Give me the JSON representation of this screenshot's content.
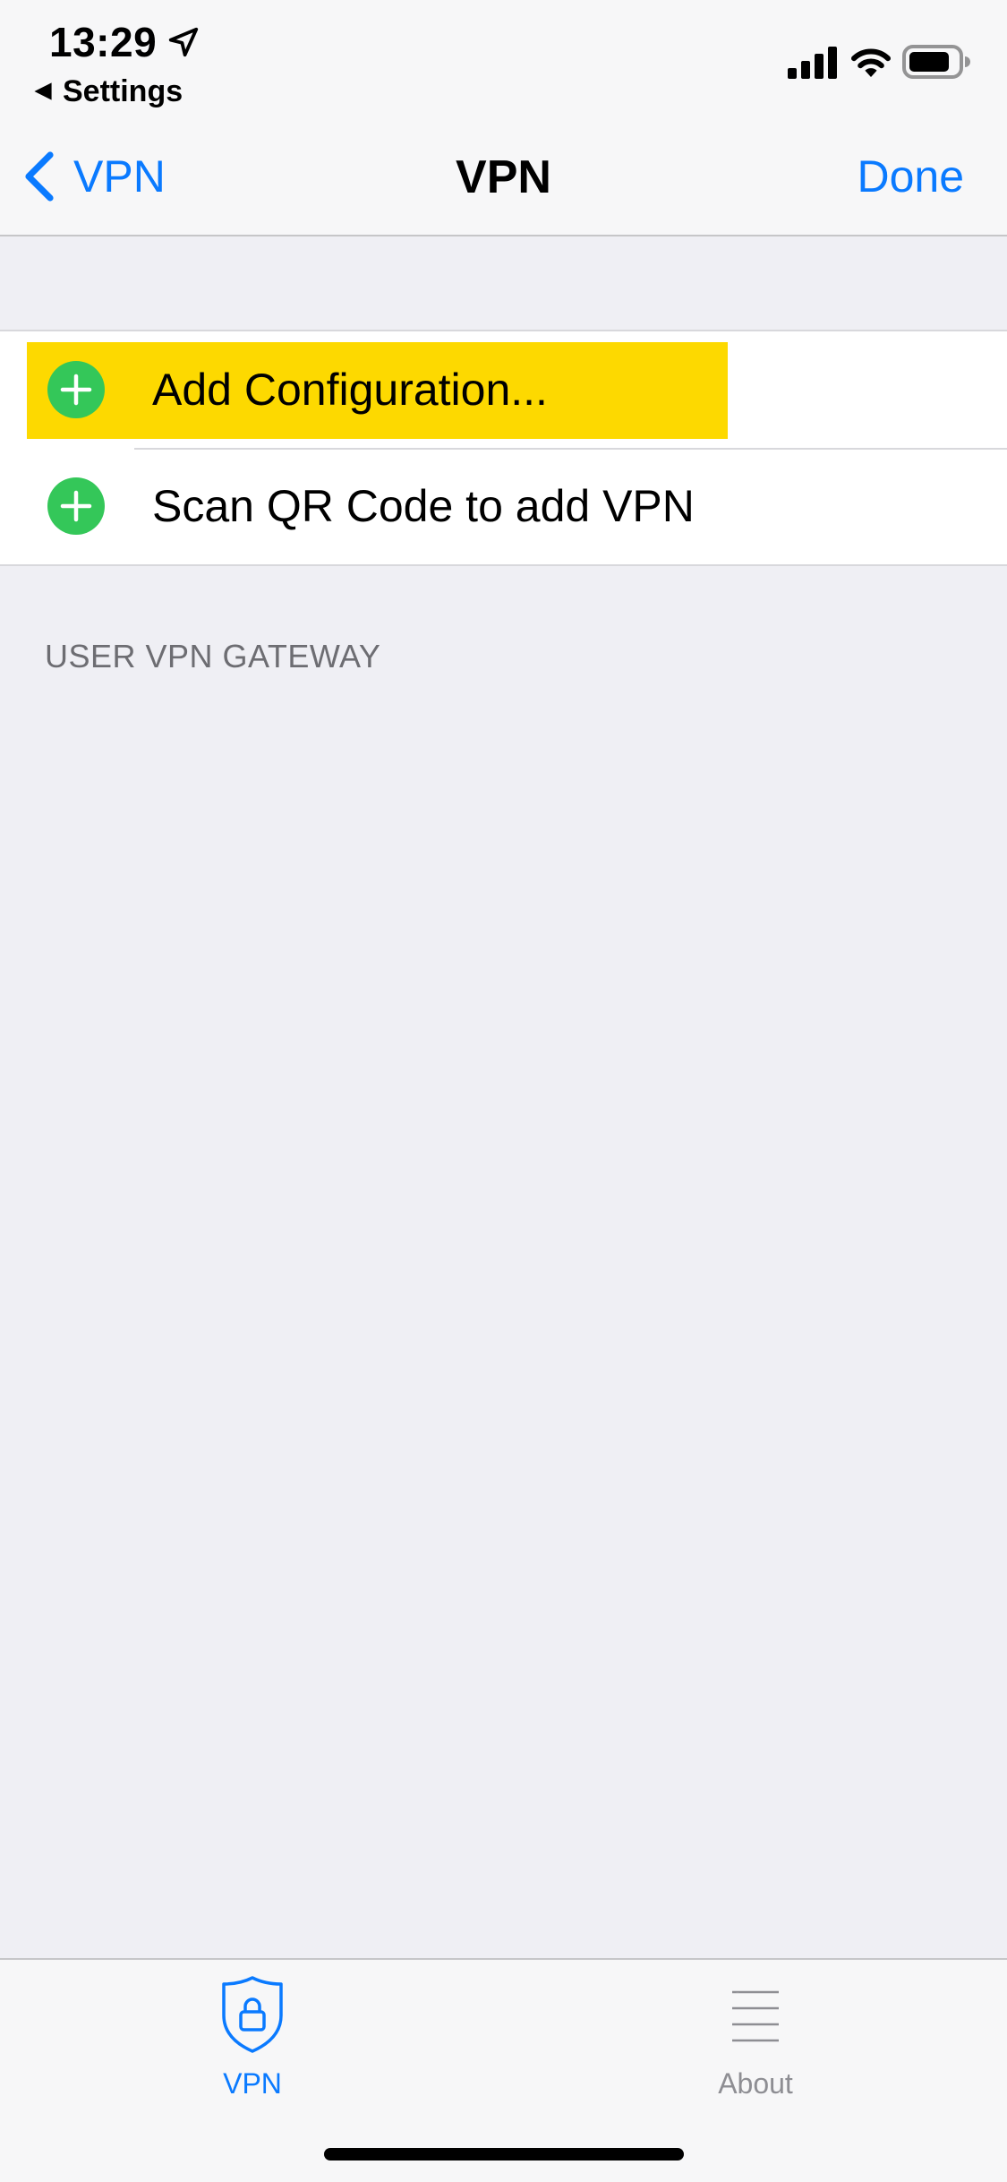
{
  "status_bar": {
    "time": "13:29",
    "back_app_label": "Settings",
    "icons": [
      "location-arrow-icon",
      "back-triangle-icon",
      "cellular-signal-icon",
      "wifi-icon",
      "battery-icon"
    ]
  },
  "nav": {
    "back_label": "VPN",
    "title": "VPN",
    "done_label": "Done"
  },
  "list": {
    "items": [
      {
        "label": "Add Configuration...",
        "icon": "plus-circle-icon",
        "highlighted": true
      },
      {
        "label": "Scan QR Code to add VPN",
        "icon": "plus-circle-icon",
        "highlighted": false
      }
    ]
  },
  "section": {
    "header": "USER VPN GATEWAY"
  },
  "tab_bar": {
    "tabs": [
      {
        "label": "VPN",
        "icon": "shield-lock-icon",
        "selected": true
      },
      {
        "label": "About",
        "icon": "list-icon",
        "selected": false
      }
    ]
  },
  "colors": {
    "accent": "#0a7aff",
    "plus_green": "#34c759",
    "highlight_yellow": "#fdd900",
    "background": "#efeff4",
    "section_header": "#6d6d72",
    "inactive_tab": "#8e8e93"
  }
}
